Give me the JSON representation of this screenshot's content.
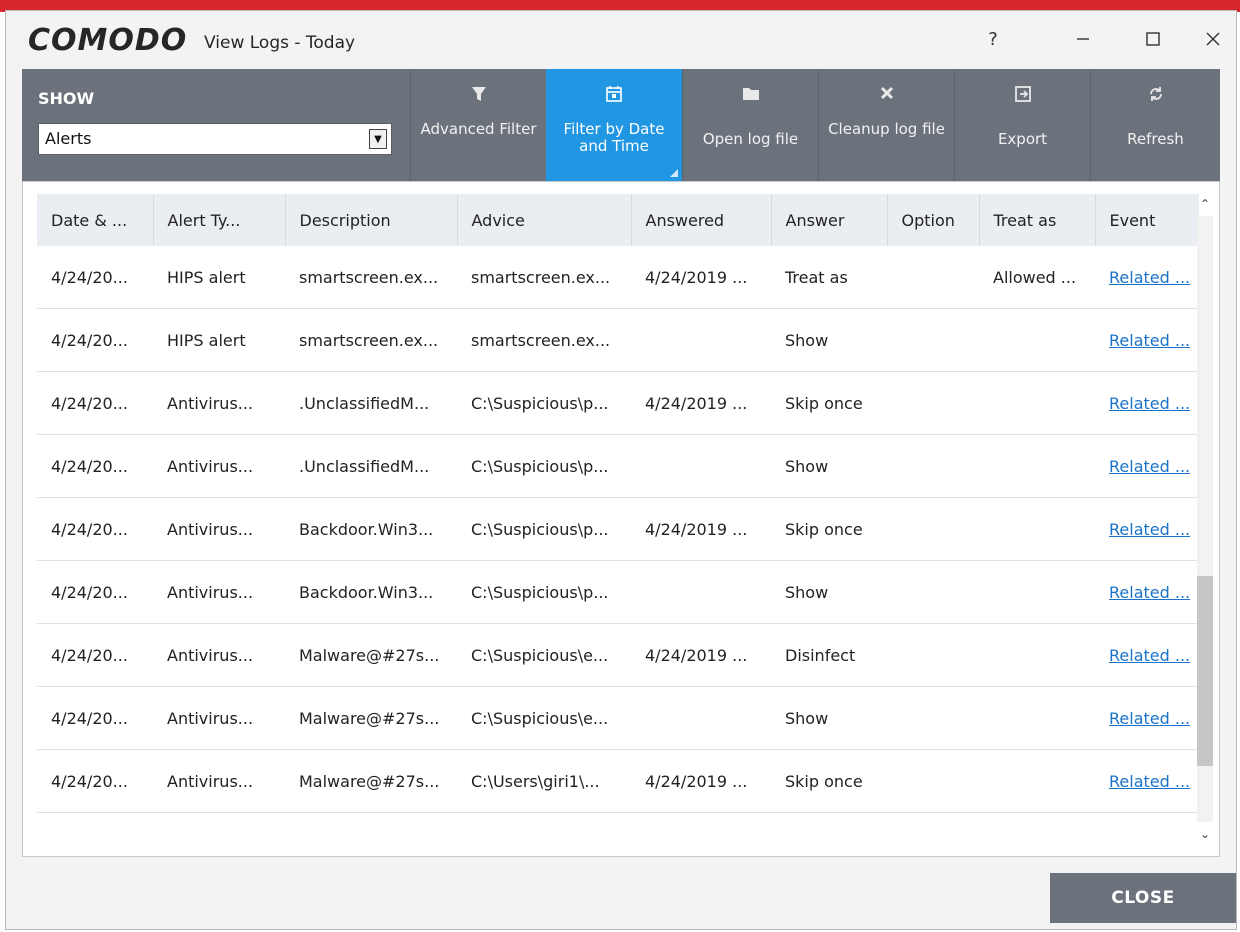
{
  "window": {
    "logo": "COMODO",
    "title": "View Logs - Today",
    "help": "?",
    "minimize": "—",
    "maximize": "☐",
    "close": "✕"
  },
  "toolbar": {
    "show_label": "SHOW",
    "show_value": "Alerts",
    "buttons": [
      {
        "label": "Advanced Filter",
        "icon": "funnel-icon"
      },
      {
        "label": "Filter by Date and Time",
        "icon": "calendar-icon",
        "active": true
      },
      {
        "label": "Open log file",
        "icon": "folder-icon"
      },
      {
        "label": "Cleanup log file",
        "icon": "x-icon"
      },
      {
        "label": "Export",
        "icon": "export-icon"
      },
      {
        "label": "Refresh",
        "icon": "refresh-icon"
      }
    ]
  },
  "table": {
    "columns": [
      "Date & ...",
      "Alert Ty...",
      "Description",
      "Advice",
      "Answered",
      "Answer",
      "Option",
      "Treat as",
      "Event"
    ],
    "rows": [
      [
        "4/24/20...",
        "HIPS alert",
        "smartscreen.ex...",
        "smartscreen.ex...",
        "4/24/2019 ...",
        "Treat as",
        "",
        "Allowed ...",
        "Related ..."
      ],
      [
        "4/24/20...",
        "HIPS alert",
        "smartscreen.ex...",
        "smartscreen.ex...",
        "",
        "Show",
        "",
        "",
        "Related ..."
      ],
      [
        "4/24/20...",
        "Antivirus...",
        ".UnclassifiedM...",
        "C:\\Suspicious\\p...",
        "4/24/2019 ...",
        "Skip once",
        "",
        "",
        "Related ..."
      ],
      [
        "4/24/20...",
        "Antivirus...",
        ".UnclassifiedM...",
        "C:\\Suspicious\\p...",
        "",
        "Show",
        "",
        "",
        "Related ..."
      ],
      [
        "4/24/20...",
        "Antivirus...",
        "Backdoor.Win3...",
        "C:\\Suspicious\\p...",
        "4/24/2019 ...",
        "Skip once",
        "",
        "",
        "Related ..."
      ],
      [
        "4/24/20...",
        "Antivirus...",
        "Backdoor.Win3...",
        "C:\\Suspicious\\p...",
        "",
        "Show",
        "",
        "",
        "Related ..."
      ],
      [
        "4/24/20...",
        "Antivirus...",
        "Malware@#27s...",
        "C:\\Suspicious\\e...",
        "4/24/2019 ...",
        "Disinfect",
        "",
        "",
        "Related ..."
      ],
      [
        "4/24/20...",
        "Antivirus...",
        "Malware@#27s...",
        "C:\\Suspicious\\e...",
        "",
        "Show",
        "",
        "",
        "Related ..."
      ],
      [
        "4/24/20...",
        "Antivirus...",
        "Malware@#27s...",
        "C:\\Users\\giri1\\...",
        "4/24/2019 ...",
        "Skip once",
        "",
        "",
        "Related ..."
      ]
    ]
  },
  "footer": {
    "close_label": "CLOSE"
  },
  "colors": {
    "accent": "#2196e3",
    "toolbar": "#6c727c",
    "link": "#1a73c9",
    "brand_strip": "#d8262f"
  }
}
